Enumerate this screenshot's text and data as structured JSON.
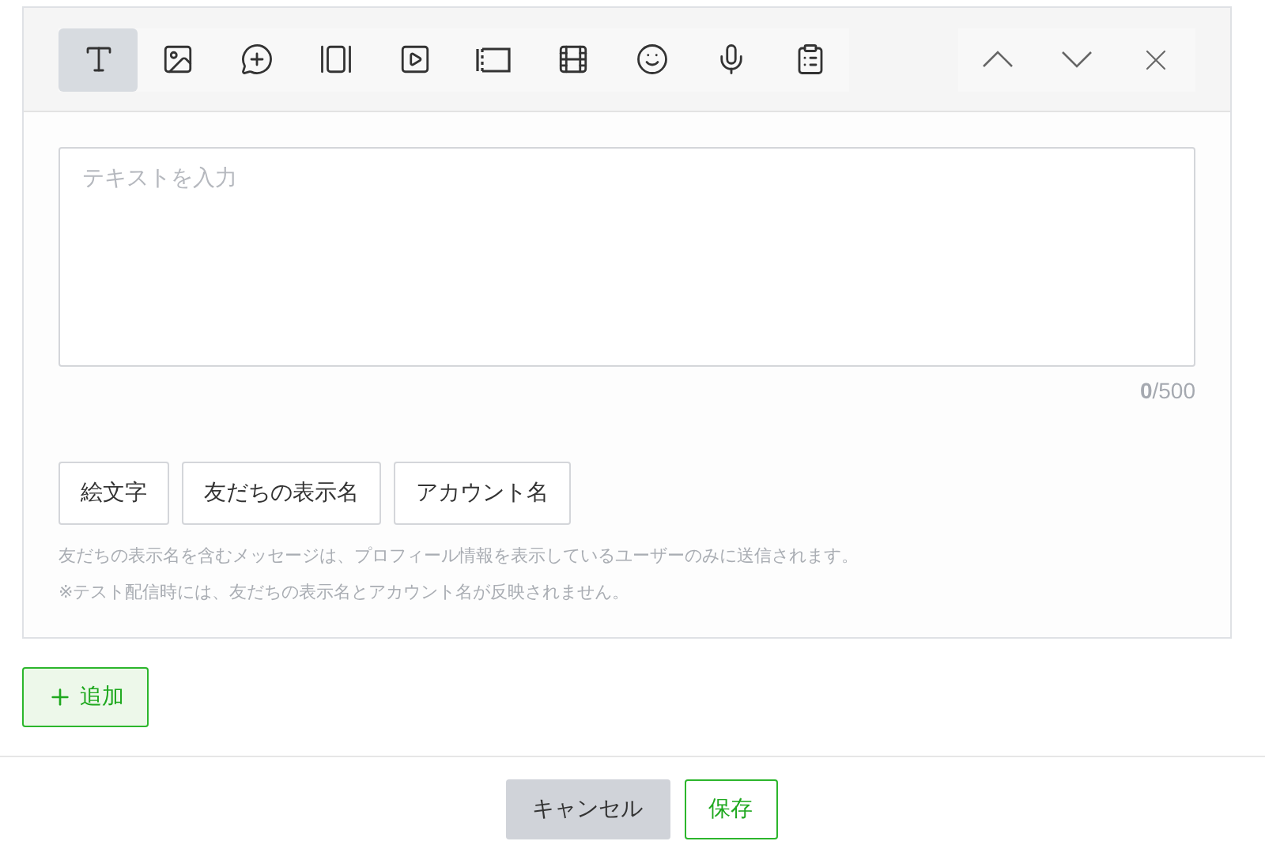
{
  "toolbar": {
    "tools": [
      {
        "kind": "text",
        "selected": true
      },
      {
        "kind": "image",
        "selected": false
      },
      {
        "kind": "bubble",
        "selected": false
      },
      {
        "kind": "carousel",
        "selected": false
      },
      {
        "kind": "video",
        "selected": false
      },
      {
        "kind": "coupon",
        "selected": false
      },
      {
        "kind": "film",
        "selected": false
      },
      {
        "kind": "smiley",
        "selected": false
      },
      {
        "kind": "mic",
        "selected": false
      },
      {
        "kind": "clipboard",
        "selected": false
      }
    ],
    "actions": [
      {
        "kind": "up"
      },
      {
        "kind": "down"
      },
      {
        "kind": "close"
      }
    ]
  },
  "editor": {
    "placeholder": "テキストを入力",
    "counter": "**0**/500"
  },
  "insert_buttons": [
    "絵文字",
    "友だちの表示名",
    "アカウント名"
  ],
  "notes": [
    "友だちの表示名を含むメッセージは、プロフィール情報を表示しているユーザーのみに送信されます。",
    "※テスト配信時には、友だちの表示名とアカウント名が反映されません。"
  ],
  "add_button": {
    "label": "追加"
  },
  "footer": {
    "cancel": "キャンセル",
    "save": "保存"
  }
}
